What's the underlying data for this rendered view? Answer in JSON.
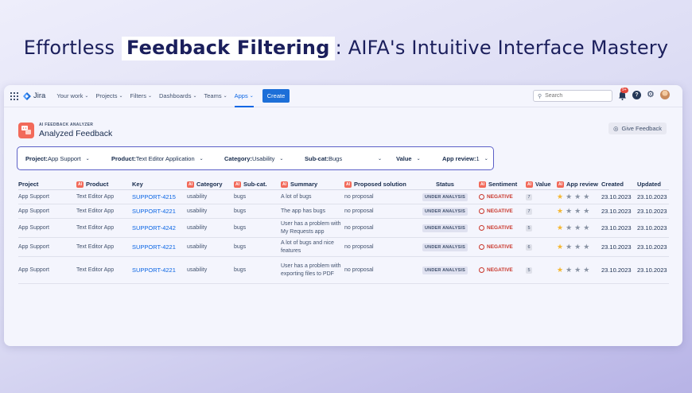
{
  "headline": {
    "part1": "Effortless ",
    "bold": "Feedback Filtering",
    "part2": ": AIFA's Intuitive Interface Mastery"
  },
  "nav": {
    "logo": "Jira",
    "items": [
      "Your work",
      "Projects",
      "Filters",
      "Dashboards",
      "Teams"
    ],
    "active": "Apps",
    "create": "Create",
    "search_placeholder": "Search",
    "notif_count": "9+",
    "help": "?"
  },
  "app": {
    "subtitle": "AI FEEDBACK ANALYZER",
    "title": "Analyzed Feedback",
    "give_feedback": "Give Feedback"
  },
  "filters": [
    {
      "label": "Project:",
      "value": " App Support"
    },
    {
      "label": "Product:",
      "value": " Text Editor Application"
    },
    {
      "label": "Category:",
      "value": " Usability"
    },
    {
      "label": "Sub-cat:",
      "value": " Bugs"
    },
    {
      "label": "Value",
      "value": ""
    },
    {
      "label": "App review:",
      "value": " 1"
    }
  ],
  "columns": {
    "project": "Project",
    "product": "Product",
    "key": "Key",
    "category": "Category",
    "subcat": "Sub-cat.",
    "summary": "Summary",
    "proposal": "Proposed solution",
    "status": "Status",
    "sentiment": "Sentiment",
    "value": "Value",
    "review": "App review",
    "created": "Created",
    "updated": "Updated",
    "ai_badge": "AI"
  },
  "rows": [
    {
      "project": "App Support",
      "product": "Text Editor App",
      "key": "SUPPORT-4215",
      "category": "usability",
      "subcat": "bugs",
      "summary": "A lot of bugs",
      "proposal": "no proposal",
      "status": "UNDER ANALYSIS",
      "sentiment": "NEGATIVE",
      "value": "7",
      "review": 1,
      "created": "23.10.2023",
      "updated": "23.10.2023"
    },
    {
      "project": "App Support",
      "product": "Text Editor App",
      "key": "SUPPORT-4221",
      "category": "usability",
      "subcat": "bugs",
      "summary": "The app has bugs",
      "proposal": "no proposal",
      "status": "UNDER ANALYSIS",
      "sentiment": "NEGATIVE",
      "value": "7",
      "review": 1,
      "created": "23.10.2023",
      "updated": "23.10.2023"
    },
    {
      "project": "App Support",
      "product": "Text Editor App",
      "key": "SUPPORT-4242",
      "category": "usability",
      "subcat": "bugs",
      "summary": "User has a problem with My Requests app",
      "proposal": "no proposal",
      "status": "UNDER ANALYSIS",
      "sentiment": "NEGATIVE",
      "value": "5",
      "review": 1,
      "created": "23.10.2023",
      "updated": "23.10.2023"
    },
    {
      "project": "App Support",
      "product": "Text Editor App",
      "key": "SUPPORT-4221",
      "category": "usability",
      "subcat": "bugs",
      "summary": "A lot of bugs and nice features",
      "proposal": "no proposal",
      "status": "UNDER ANALYSIS",
      "sentiment": "NEGATIVE",
      "value": "6",
      "review": 1,
      "created": "23.10.2023",
      "updated": "23.10.2023"
    },
    {
      "project": "App Support",
      "product": "Text Editor App",
      "key": "SUPPORT-4221",
      "category": "usability",
      "subcat": "bugs",
      "summary": "User has a problem with exporting files to PDF",
      "proposal": "no proposal",
      "status": "UNDER ANALYSIS",
      "sentiment": "NEGATIVE",
      "value": "5",
      "review": 1,
      "created": "23.10.2023",
      "updated": "23.10.2023"
    }
  ]
}
